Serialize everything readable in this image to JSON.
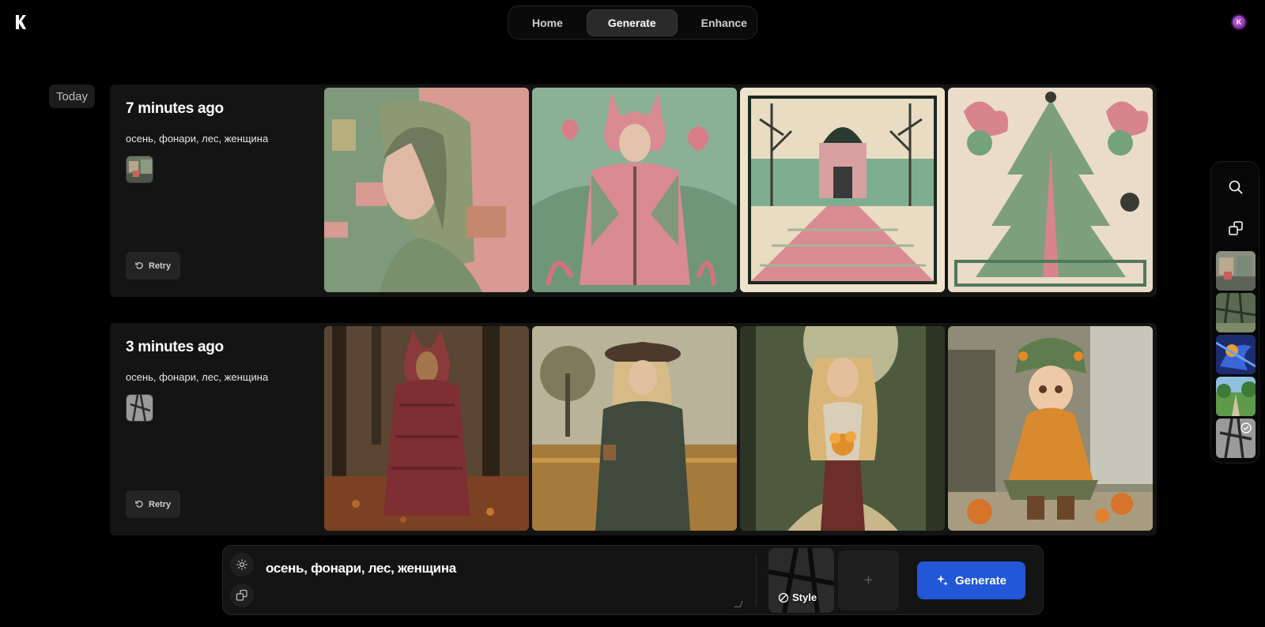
{
  "nav": {
    "tabs": [
      {
        "label": "Home"
      },
      {
        "label": "Generate",
        "active": true
      },
      {
        "label": "Enhance"
      }
    ]
  },
  "user": {
    "avatar_initial": "K"
  },
  "feed": {
    "group_label": "Today",
    "generations": [
      {
        "time": "7 minutes ago",
        "prompt": "осень, фонари, лес, женщина",
        "retry_label": "Retry",
        "images": [
          "woman-portrait-pink-green",
          "girl-bunny-hood-jacket",
          "park-alley-dome-building",
          "decorated-christmas-tree-poster"
        ]
      },
      {
        "time": "3 minutes ago",
        "prompt": "осень, фонари, лес, женщина",
        "retry_label": "Retry",
        "images": [
          "dog-in-red-scarf-autumn",
          "cowgirl-in-field",
          "blonde-girl-with-flowers",
          "cartoon-girl-with-pumpkins"
        ]
      }
    ]
  },
  "rail": {
    "icons": [
      "search-icon",
      "remix-icon"
    ],
    "thumbnails": [
      "street-scene",
      "forest-scene",
      "blue-abstract",
      "garden-path",
      "tree-silhouette-selected"
    ]
  },
  "prompt_bar": {
    "value": "осень, фонари, лес, женщина",
    "style_label": "Style",
    "add_label": "+",
    "generate_label": "Generate"
  },
  "colors": {
    "accent": "#2257d8",
    "background": "#000000",
    "card": "#141414",
    "avatar": "#a23fc4"
  }
}
